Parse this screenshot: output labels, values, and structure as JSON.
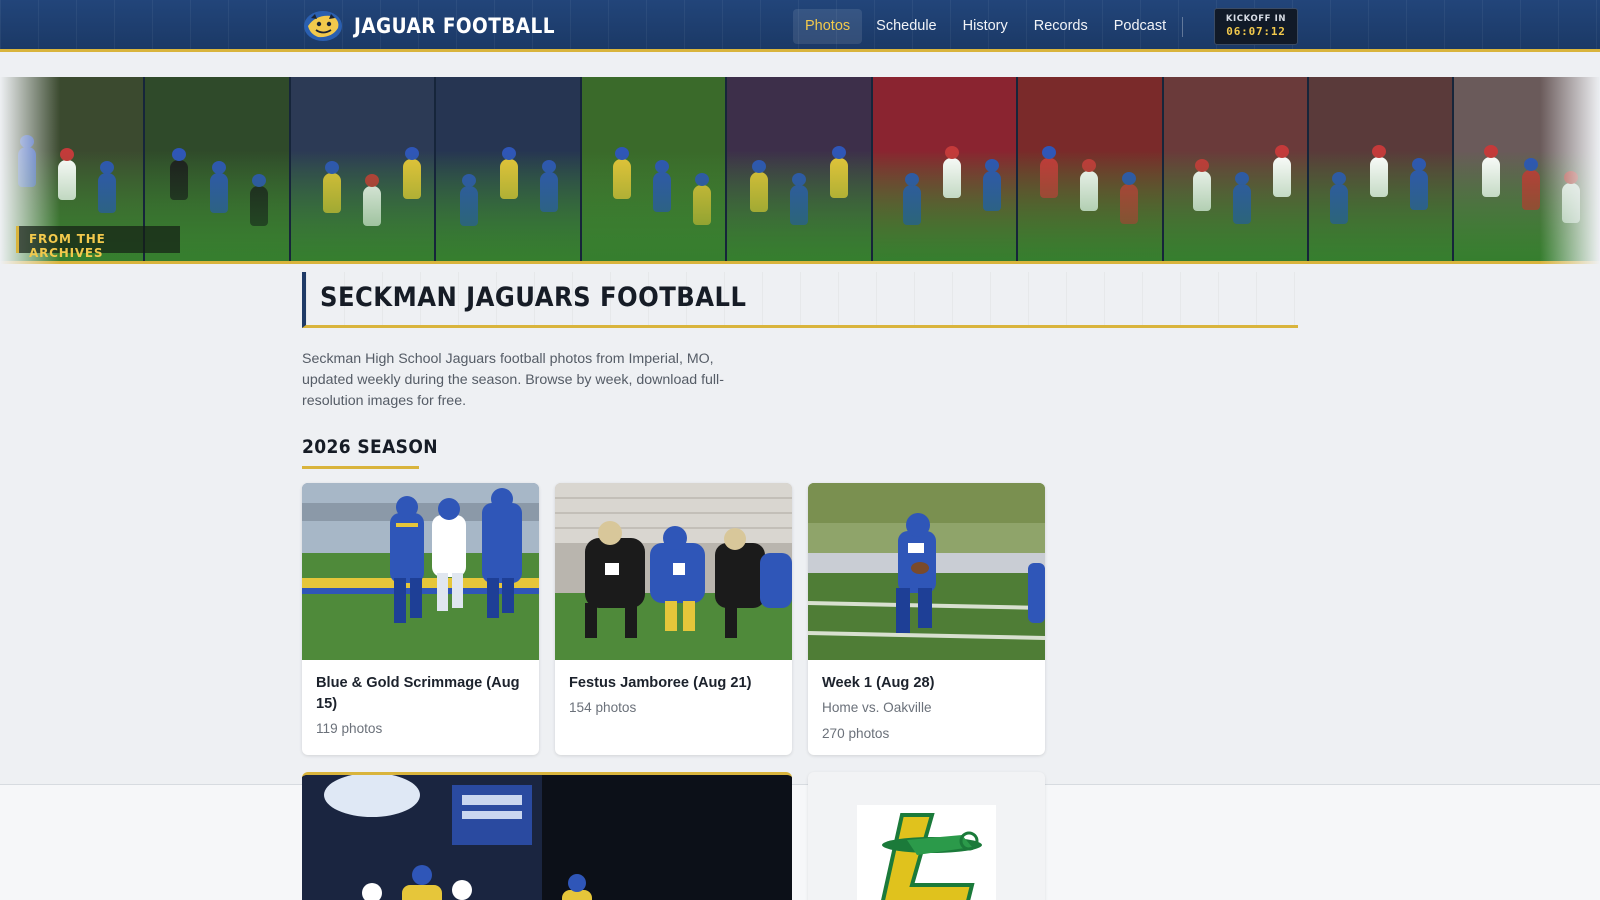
{
  "brand": {
    "name": "JAGUAR FOOTBALL",
    "logo_icon": "jaguar-logo-icon"
  },
  "nav": {
    "items": [
      {
        "label": "Photos",
        "active": true
      },
      {
        "label": "Schedule",
        "active": false
      },
      {
        "label": "History",
        "active": false
      },
      {
        "label": "Records",
        "active": false
      },
      {
        "label": "Podcast",
        "active": false
      }
    ]
  },
  "kickoff": {
    "label": "KICKOFF IN",
    "time": "06:07:12"
  },
  "strip": {
    "tag": "FROM THE ARCHIVES",
    "photo_count": 11
  },
  "main": {
    "title": "SECKMAN JAGUARS FOOTBALL",
    "intro": "Seckman High School Jaguars football photos from Imperial, MO, updated weekly during the season. Browse by week, download full-resolution images for free.",
    "season_heading": "2026 SEASON"
  },
  "cards": [
    {
      "title": "Blue & Gold Scrimmage (Aug 15)",
      "subtitle": "",
      "count": "119 photos"
    },
    {
      "title": "Festus Jamboree (Aug 21)",
      "subtitle": "",
      "count": "154 photos"
    },
    {
      "title": "Week 1 (Aug 28)",
      "subtitle": "Home vs. Oakville",
      "count": "270 photos"
    }
  ],
  "colors": {
    "navy": "#1f3a66",
    "gold": "#d9b43c",
    "team_blue": "#2f56b8",
    "field_green": "#4f8a3a"
  }
}
